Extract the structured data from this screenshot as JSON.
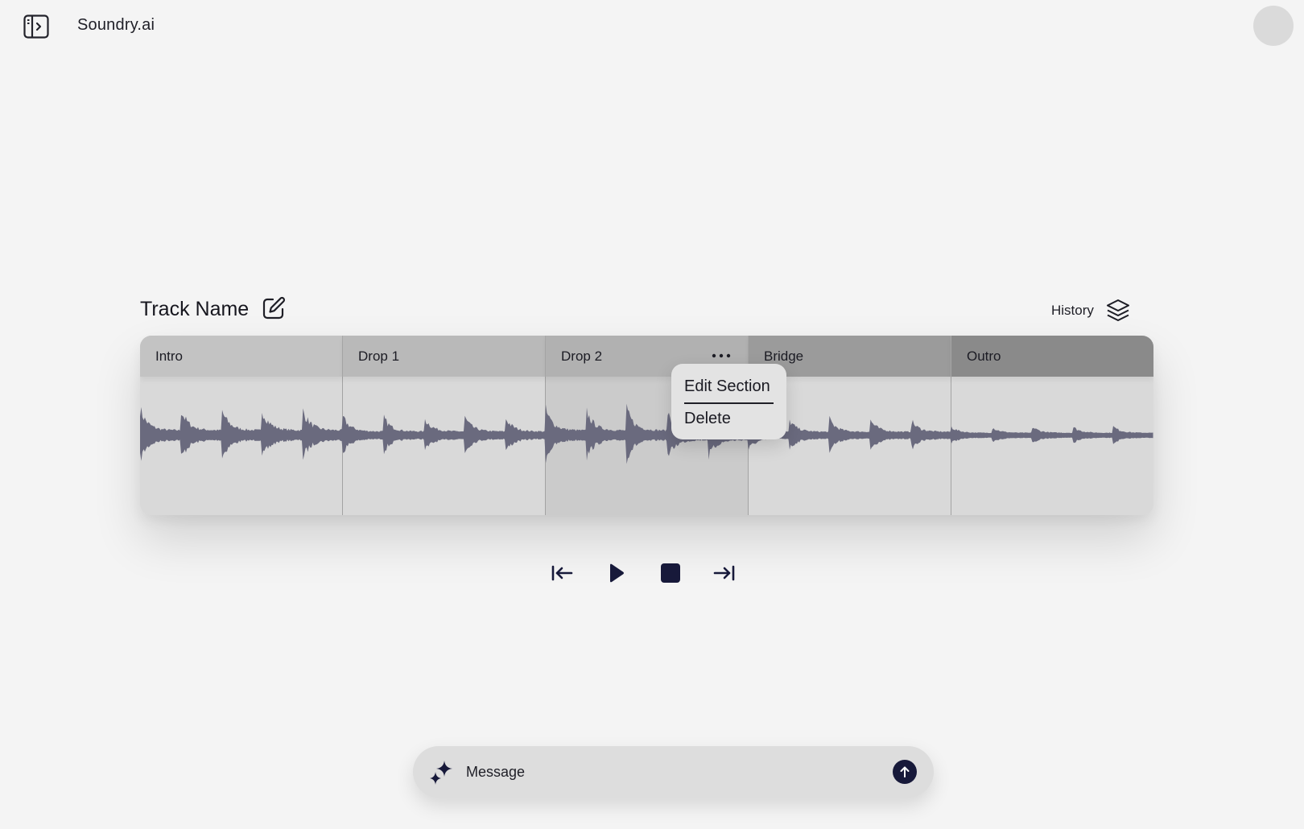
{
  "app": {
    "title": "Soundry.ai"
  },
  "track": {
    "name": "Track Name"
  },
  "history": {
    "label": "History"
  },
  "sections": [
    {
      "label": "Intro",
      "header_color": "#c3c3c3",
      "body_color": "#d9d9d9",
      "amp": 0.62
    },
    {
      "label": "Drop 1",
      "header_color": "#b9b9b9",
      "body_color": "#d9d9d9",
      "amp": 0.42
    },
    {
      "label": "Drop 2",
      "header_color": "#b1b1b1",
      "body_color": "#cbcbcb",
      "amp": 0.6
    },
    {
      "label": "Bridge",
      "header_color": "#9b9b9b",
      "body_color": "#d9d9d9",
      "amp": 0.36
    },
    {
      "label": "Outro",
      "header_color": "#8a8a8a",
      "body_color": "#d9d9d9",
      "amp": 0.18
    }
  ],
  "context_menu": {
    "edit_label": "Edit Section",
    "delete_label": "Delete"
  },
  "composer": {
    "placeholder": "Message"
  },
  "colors": {
    "waveform": "#6a6a7e",
    "accent": "#17193a"
  }
}
